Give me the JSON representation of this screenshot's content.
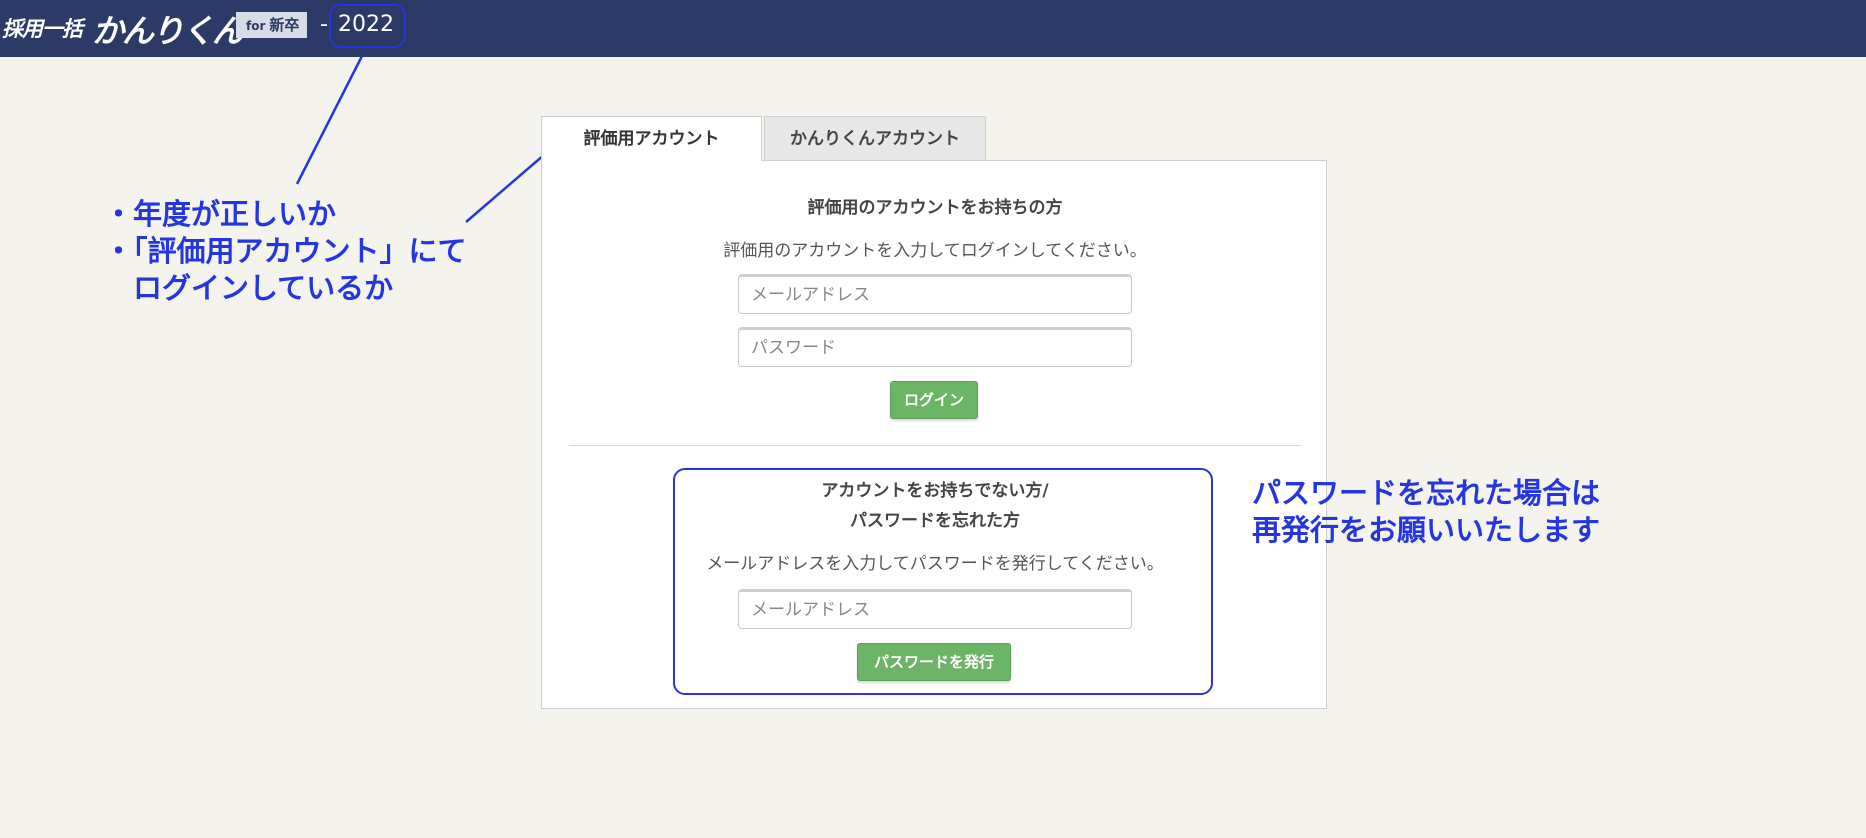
{
  "header": {
    "logo_prefix": "採用一括",
    "logo_main": "かんりくん",
    "logo_tag_for": "for",
    "logo_tag_label": "新卒",
    "separator": "-",
    "year": "2022"
  },
  "tabs": [
    {
      "label": "評価用アカウント",
      "active": true
    },
    {
      "label": "かんりくんアカウント",
      "active": false
    }
  ],
  "login": {
    "heading": "評価用のアカウントをお持ちの方",
    "description": "評価用のアカウントを入力してログインしてください。",
    "email_placeholder": "メールアドレス",
    "password_placeholder": "パスワード",
    "submit_label": "ログイン"
  },
  "register": {
    "heading_line1": "アカウントをお持ちでない方/",
    "heading_line2": "パスワードを忘れた方",
    "description": "メールアドレスを入力してパスワードを発行してください。",
    "email_placeholder": "メールアドレス",
    "submit_label": "パスワードを発行"
  },
  "annotations": {
    "left_line1": "・年度が正しいか",
    "left_line2": "・「評価用アカウント」にて",
    "left_line3": "　ログインしているか",
    "right_line1": "パスワードを忘れた場合は",
    "right_line2": "再発行をお願いいたします"
  },
  "colors": {
    "header_bg": "#2b3a66",
    "accent_button": "#6cb466",
    "annotation": "#2535e0"
  }
}
